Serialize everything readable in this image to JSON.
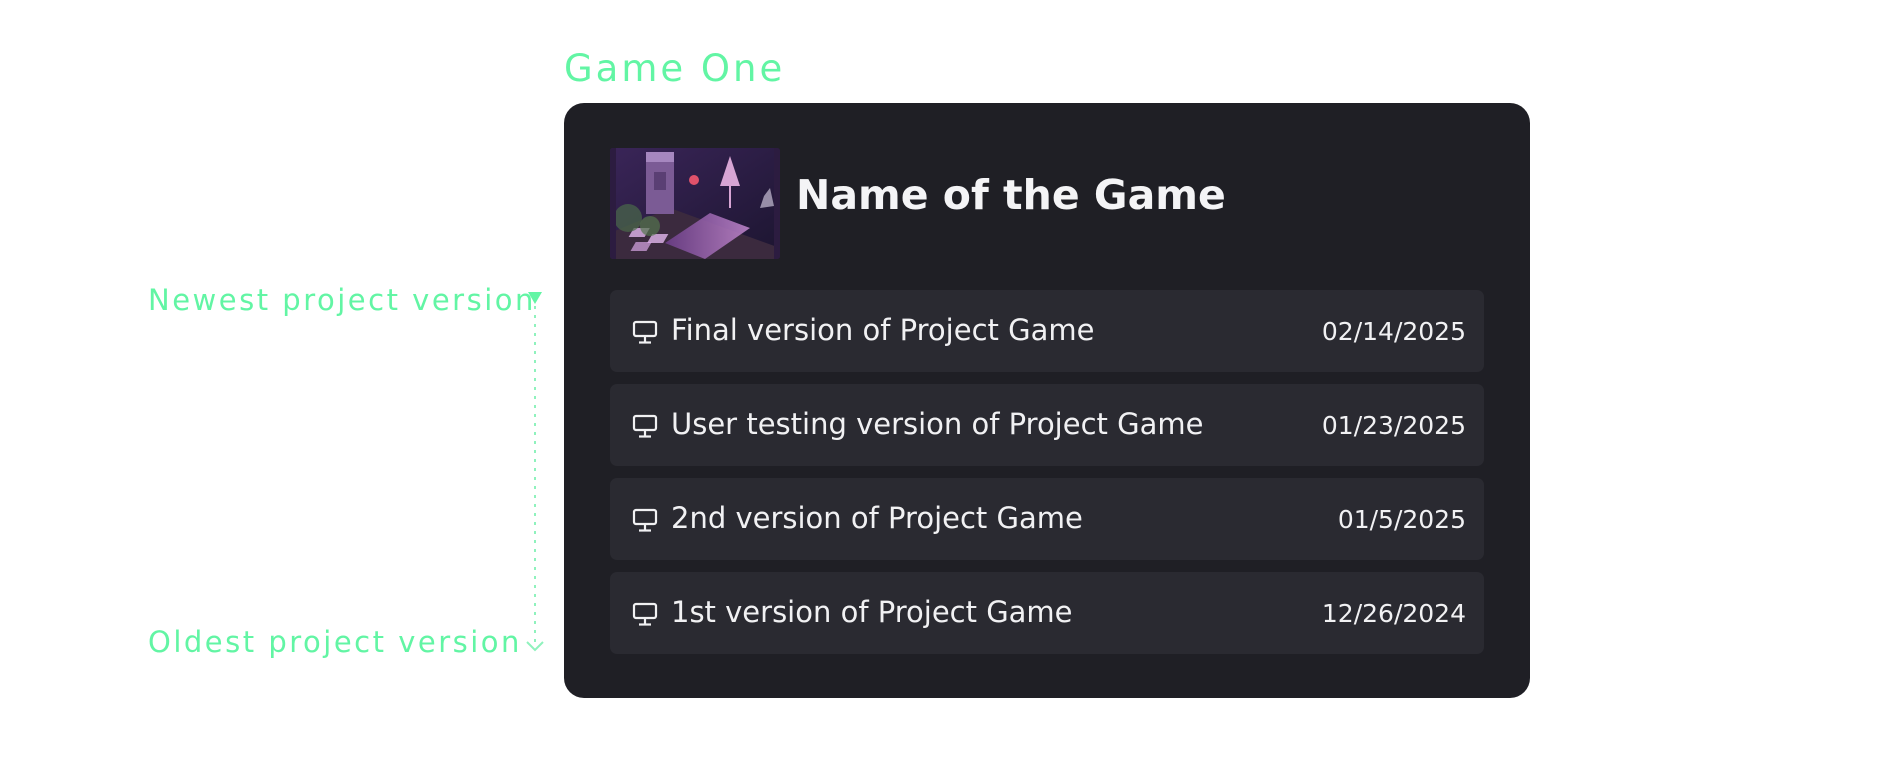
{
  "section_label": "Game One",
  "annotations": {
    "newest": "Newest project version",
    "oldest": "Oldest project version"
  },
  "accent_color": "#62f5a4",
  "card": {
    "game_name": "Name of the Game",
    "thumbnail_icon": "game-thumbnail-image",
    "versions": [
      {
        "icon": "monitor-icon",
        "title": "Final version of Project Game",
        "date": "02/14/2025"
      },
      {
        "icon": "monitor-icon",
        "title": "User testing version of Project Game",
        "date": "01/23/2025"
      },
      {
        "icon": "monitor-icon",
        "title": "2nd version of Project Game",
        "date": "01/5/2025"
      },
      {
        "icon": "monitor-icon",
        "title": "1st version of Project Game",
        "date": "12/26/2024"
      }
    ]
  }
}
